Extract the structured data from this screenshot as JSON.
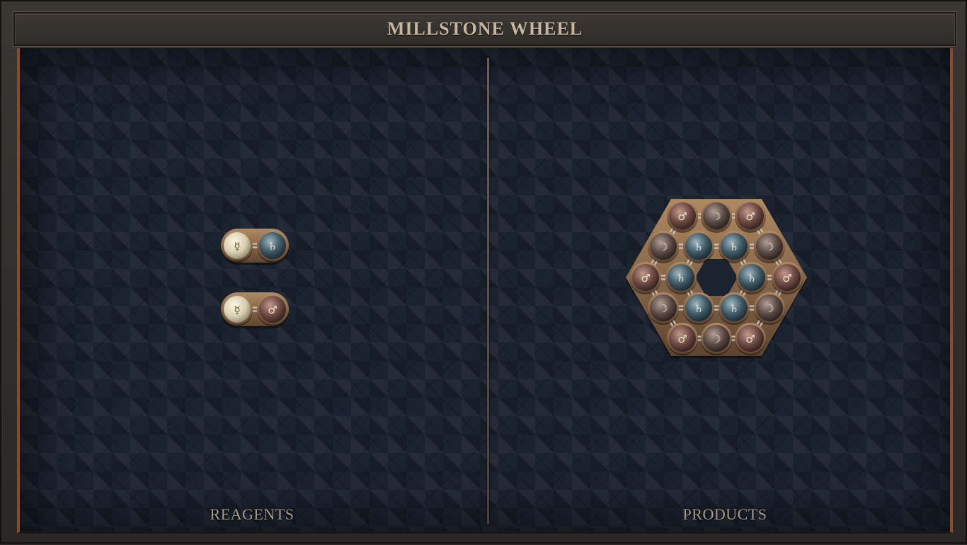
{
  "title": "MILLSTONE WHEEL",
  "panels": {
    "reagents_label": "REAGENTS",
    "products_label": "PRODUCTS"
  },
  "symbols": {
    "quicksilver": "☿",
    "lead": "♄",
    "iron": "♂",
    "silver": "☽"
  },
  "reagents": [
    {
      "atoms": [
        "quicksilver",
        "lead"
      ]
    },
    {
      "atoms": [
        "quicksilver",
        "iron"
      ]
    }
  ],
  "product": {
    "atom_count": 18,
    "outer_ring": [
      "iron",
      "silver",
      "iron",
      "silver",
      "iron",
      "silver",
      "iron",
      "silver",
      "iron",
      "silver",
      "iron",
      "silver"
    ],
    "inner_ring": [
      "lead",
      "lead",
      "lead",
      "lead",
      "lead",
      "lead"
    ]
  },
  "colors": {
    "quicksilver": "#d8cfb2",
    "lead": "#3f5a66",
    "iron": "#6e4a44",
    "silver": "#5b4a46",
    "glyph_light": "#eae2d0",
    "glyph_quicksilver": "#6b5a2e",
    "bronze": "#8a6a4a"
  }
}
